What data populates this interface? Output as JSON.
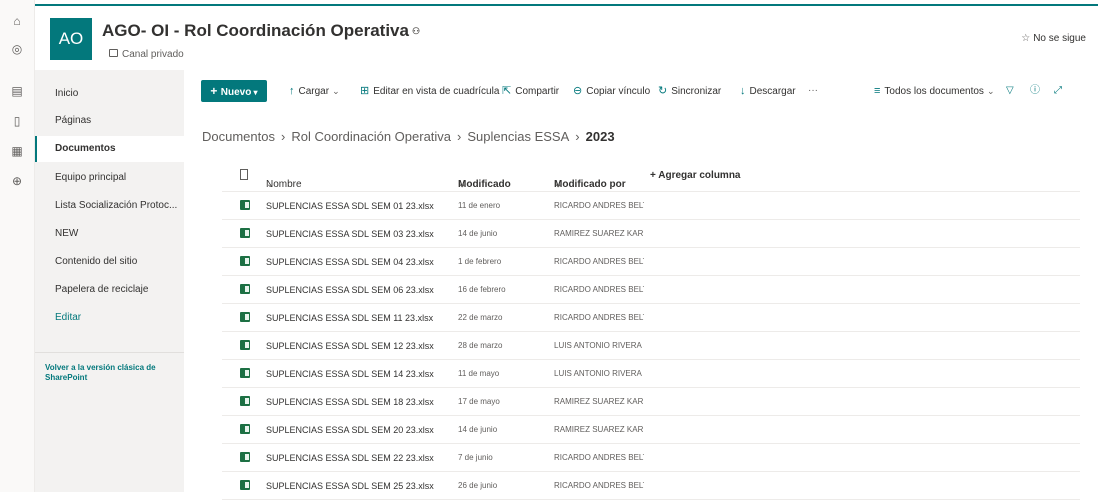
{
  "rail": {
    "icons": [
      "home-icon",
      "globe-icon",
      "news-icon",
      "document-icon",
      "library-icon",
      "add-icon"
    ]
  },
  "site": {
    "logo_initials": "AO",
    "title": "AGO- OI - Rol Coordinación Operativa",
    "privacy": "Canal privado",
    "follow_label": "No se sigue"
  },
  "nav": {
    "items": [
      {
        "label": "Inicio"
      },
      {
        "label": "Páginas"
      },
      {
        "label": "Documentos"
      },
      {
        "label": "Equipo principal"
      },
      {
        "label": "Lista Socialización Protoc..."
      },
      {
        "label": "NEW"
      },
      {
        "label": "Contenido del sitio"
      },
      {
        "label": "Papelera de reciclaje"
      },
      {
        "label": "Editar"
      }
    ],
    "active_index": 2,
    "classic_link": "Volver a la versión clásica de SharePoint"
  },
  "commands": {
    "new": "Nuevo",
    "upload": "Cargar",
    "grid_edit": "Editar en vista de cuadrícula",
    "share": "Compartir",
    "copy_link": "Copiar vínculo",
    "sync": "Sincronizar",
    "download": "Descargar",
    "more": "···",
    "view": "Todos los documentos"
  },
  "breadcrumb": [
    "Documentos",
    "Rol Coordinación Operativa",
    "Suplencias ESSA",
    "2023"
  ],
  "columns": {
    "name": "Nombre",
    "modified": "Modificado",
    "modified_by": "Modificado por",
    "add_column": "+ Agregar columna"
  },
  "files": [
    {
      "name": "SUPLENCIAS ESSA SDL SEM 01 23.xlsx",
      "modified": "11 de enero",
      "by": "RICARDO ANDRES BELTRA"
    },
    {
      "name": "SUPLENCIAS ESSA SDL SEM 03 23.xlsx",
      "modified": "14 de junio",
      "by": "RAMIREZ SUAREZ KAREN"
    },
    {
      "name": "SUPLENCIAS ESSA SDL SEM 04 23.xlsx",
      "modified": "1 de febrero",
      "by": "RICARDO ANDRES BELTRA"
    },
    {
      "name": "SUPLENCIAS ESSA SDL SEM 06 23.xlsx",
      "modified": "16 de febrero",
      "by": "RICARDO ANDRES BELTRA"
    },
    {
      "name": "SUPLENCIAS ESSA SDL SEM 11 23.xlsx",
      "modified": "22 de marzo",
      "by": "RICARDO ANDRES BELTRA"
    },
    {
      "name": "SUPLENCIAS ESSA SDL SEM 12 23.xlsx",
      "modified": "28 de marzo",
      "by": "LUIS ANTONIO RIVERA PI"
    },
    {
      "name": "SUPLENCIAS ESSA SDL SEM 14 23.xlsx",
      "modified": "11 de mayo",
      "by": "LUIS ANTONIO RIVERA PI"
    },
    {
      "name": "SUPLENCIAS ESSA SDL SEM 18 23.xlsx",
      "modified": "17 de mayo",
      "by": "RAMIREZ SUAREZ KAREN"
    },
    {
      "name": "SUPLENCIAS ESSA SDL SEM 20 23.xlsx",
      "modified": "14 de junio",
      "by": "RAMIREZ SUAREZ KAREN"
    },
    {
      "name": "SUPLENCIAS ESSA SDL SEM 22 23.xlsx",
      "modified": "7 de junio",
      "by": "RICARDO ANDRES BELTRA"
    },
    {
      "name": "SUPLENCIAS ESSA SDL SEM 25 23.xlsx",
      "modified": "26 de junio",
      "by": "RICARDO ANDRES BELTRA"
    }
  ],
  "colors": {
    "accent": "#03787c",
    "excel": "#1d7044"
  }
}
